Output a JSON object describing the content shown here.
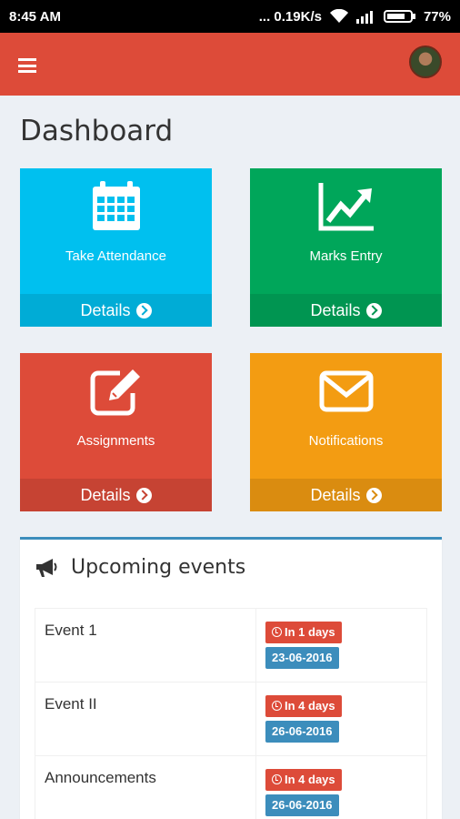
{
  "status_bar": {
    "time": "8:45 AM",
    "network_speed": "... 0.19K/s",
    "battery": "77%"
  },
  "app_bar": {
    "menu_icon": "hamburger-icon",
    "avatar": "user-avatar"
  },
  "page": {
    "title": "Dashboard"
  },
  "tiles": [
    {
      "label": "Take Attendance",
      "footer": "Details",
      "icon": "calendar-icon",
      "color": "#00c0ef"
    },
    {
      "label": "Marks Entry",
      "footer": "Details",
      "icon": "line-chart-icon",
      "color": "#00a65a"
    },
    {
      "label": "Assignments",
      "footer": "Details",
      "icon": "edit-icon",
      "color": "#dd4b39"
    },
    {
      "label": "Notifications",
      "footer": "Details",
      "icon": "envelope-icon",
      "color": "#f39c12"
    }
  ],
  "events": {
    "title": "Upcoming events",
    "icon": "bullhorn-icon",
    "rows": [
      {
        "name": "Event 1",
        "days": "In 1 days",
        "date": "23-06-2016"
      },
      {
        "name": "Event II",
        "days": "In 4 days",
        "date": "26-06-2016"
      },
      {
        "name": "Announcements",
        "days": "In 4 days",
        "date": "26-06-2016"
      }
    ]
  }
}
